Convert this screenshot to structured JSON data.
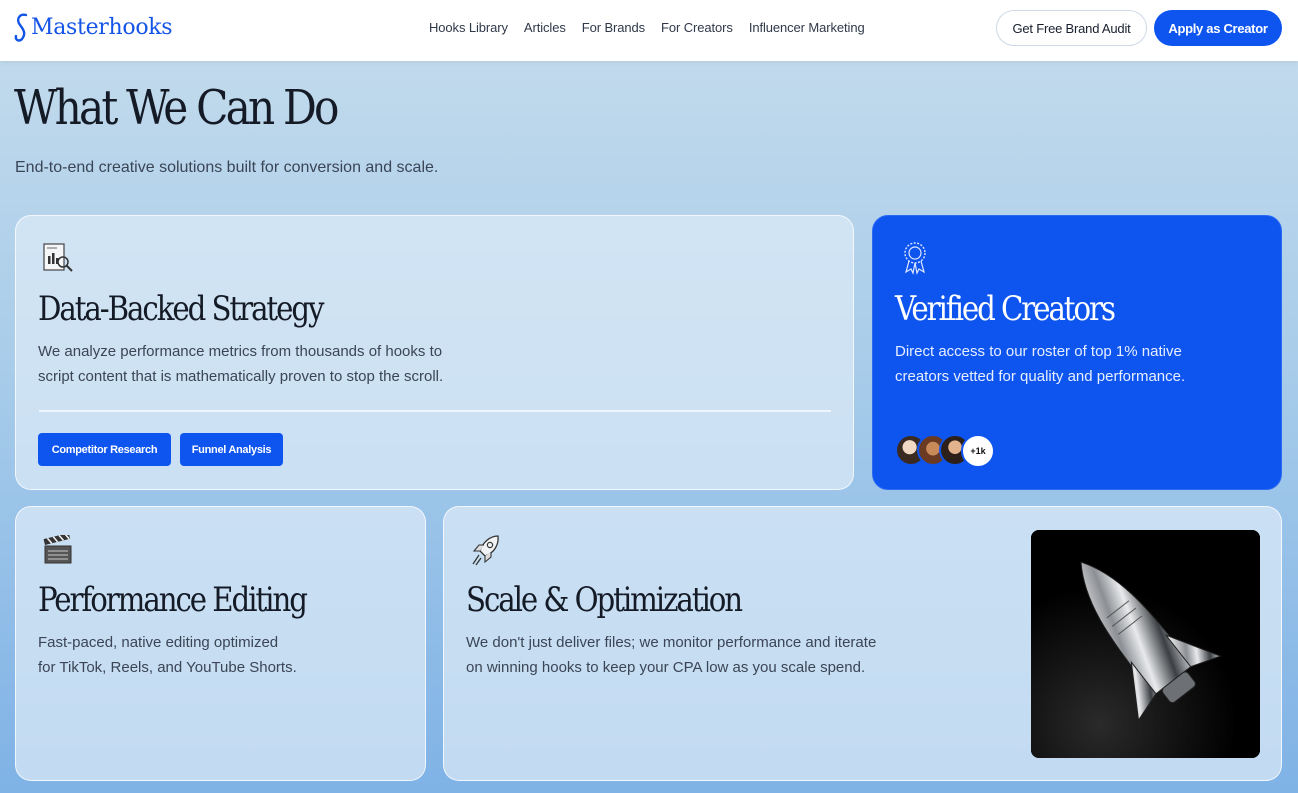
{
  "header": {
    "logo_text": "Masterhooks",
    "nav": [
      "Hooks Library",
      "Articles",
      "For Brands",
      "For Creators",
      "Influencer Marketing"
    ],
    "audit_button": "Get Free Brand Audit",
    "apply_button": "Apply as Creator"
  },
  "hero": {
    "title": "What We Can Do",
    "subtitle": "End-to-end creative solutions built for conversion and scale."
  },
  "cards": {
    "data_strategy": {
      "icon": "chart-report-icon",
      "title": "Data-Backed Strategy",
      "text_line1": "We analyze performance metrics from thousands of hooks to",
      "text_line2": "script content that is mathematically proven to stop the scroll.",
      "tags": [
        "Competitor Research",
        "Funnel Analysis"
      ]
    },
    "verified_creators": {
      "icon": "award-badge-icon",
      "title": "Verified Creators",
      "text_line1": "Direct access to our roster of top 1% native",
      "text_line2": "creators vetted for quality and performance.",
      "more_count": "+1k"
    },
    "performance_editing": {
      "icon": "clapperboard-icon",
      "title": "Performance Editing",
      "text_line1": "Fast-paced, native editing optimized",
      "text_line2": "for TikTok, Reels, and YouTube Shorts."
    },
    "scale_optimization": {
      "icon": "rocket-icon",
      "title": "Scale & Optimization",
      "text_line1": "We don't just deliver files; we monitor performance and iterate",
      "text_line2": "on winning hooks to keep your CPA low as you scale spend."
    }
  },
  "colors": {
    "brand": "#0e55f0",
    "heading": "#151b26",
    "body": "#3b4556"
  }
}
